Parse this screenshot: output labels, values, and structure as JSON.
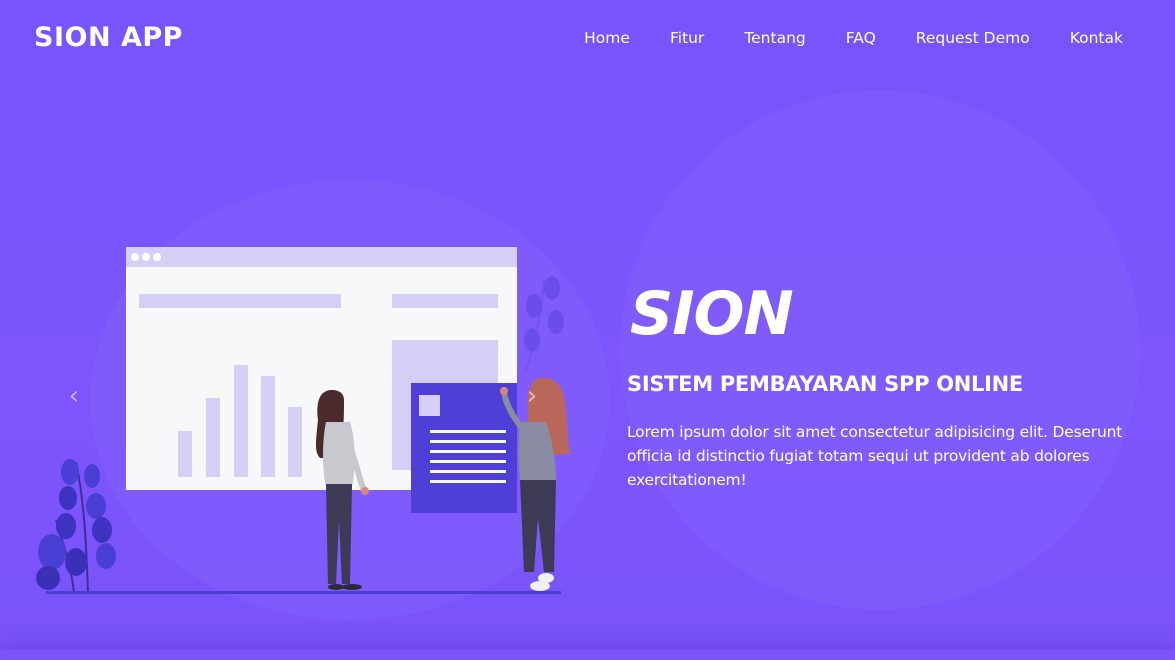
{
  "header": {
    "brand": "SION APP",
    "nav": [
      "Home",
      "Fitur",
      "Tentang",
      "FAQ",
      "Request Demo",
      "Kontak"
    ]
  },
  "hero": {
    "title": "SION",
    "subtitle": "SISTEM PEMBAYARAN SPP ONLINE",
    "description": "Lorem ipsum dolor sit amet consectetur adipisicing elit. Deserunt officia id distinctio fugiat totam sequi ut provident ab dolores exercitationem!"
  },
  "carousel": {
    "prev_icon": "chevron-left-icon",
    "next_icon": "chevron-right-icon",
    "prev_glyph": "‹",
    "next_glyph": "›"
  },
  "colors": {
    "background": "#7854fd",
    "accent": "#4f3fd6",
    "card": "#f7f8fa",
    "chart_bar": "#d5cff5"
  }
}
